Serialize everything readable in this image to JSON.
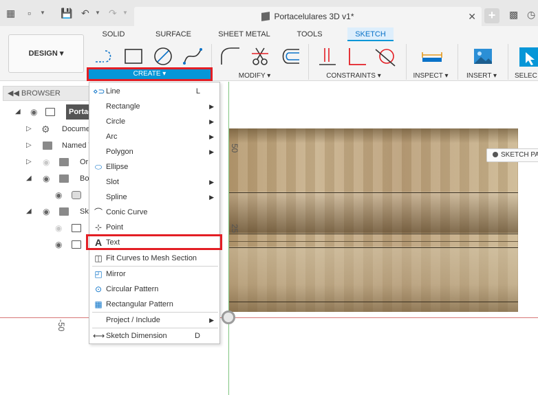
{
  "window": {
    "doc_title": "Portacelulares 3D v1*"
  },
  "toolbar": {
    "workspace_label": "DESIGN",
    "tabs": [
      {
        "label": "SOLID",
        "active": false
      },
      {
        "label": "SURFACE",
        "active": false
      },
      {
        "label": "SHEET METAL",
        "active": false
      },
      {
        "label": "TOOLS",
        "active": false
      },
      {
        "label": "SKETCH",
        "active": true
      }
    ],
    "groups": {
      "create": "CREATE",
      "modify": "MODIFY",
      "constraints": "CONSTRAINTS",
      "inspect": "INSPECT",
      "insert": "INSERT",
      "select": "SELEC"
    },
    "accent_color": "#0696d7",
    "highlight_color": "#e31e24"
  },
  "browser": {
    "title": "BROWSER",
    "items": [
      {
        "label": "Portac"
      },
      {
        "label": "Docume"
      },
      {
        "label": "Named V"
      },
      {
        "label": "Or"
      },
      {
        "label": "Bo"
      },
      {
        "label": "Sk"
      }
    ]
  },
  "canvas": {
    "dim_50": "50",
    "dim_25": "25",
    "dim_neg50": "-50",
    "sketch_palette_label": "SKETCH PA"
  },
  "create_menu": {
    "items": [
      {
        "label": "Line",
        "shortcut": "L",
        "icon": "line-icon"
      },
      {
        "label": "Rectangle",
        "icon": "rectangle-icon"
      },
      {
        "label": "Circle",
        "icon": "circle-icon"
      },
      {
        "label": "Arc",
        "icon": "arc-icon"
      },
      {
        "label": "Polygon",
        "icon": "polygon-icon"
      },
      {
        "label": "Ellipse",
        "icon": "ellipse-icon"
      },
      {
        "label": "Slot",
        "icon": "slot-icon"
      },
      {
        "label": "Spline",
        "icon": "spline-icon"
      },
      {
        "label": "Conic Curve",
        "icon": "conic-curve-icon"
      },
      {
        "label": "Point",
        "icon": "point-icon"
      },
      {
        "label": "Text",
        "icon": "text-icon"
      },
      {
        "label": "Fit Curves to Mesh Section",
        "icon": "fit-curves-icon"
      },
      {
        "label": "Mirror",
        "icon": "mirror-icon"
      },
      {
        "label": "Circular Pattern",
        "icon": "circular-pattern-icon"
      },
      {
        "label": "Rectangular Pattern",
        "icon": "rectangular-pattern-icon"
      },
      {
        "label": "Project / Include",
        "icon": "project-include-icon"
      },
      {
        "label": "Sketch Dimension",
        "shortcut": "D",
        "icon": "sketch-dimension-icon"
      }
    ]
  }
}
